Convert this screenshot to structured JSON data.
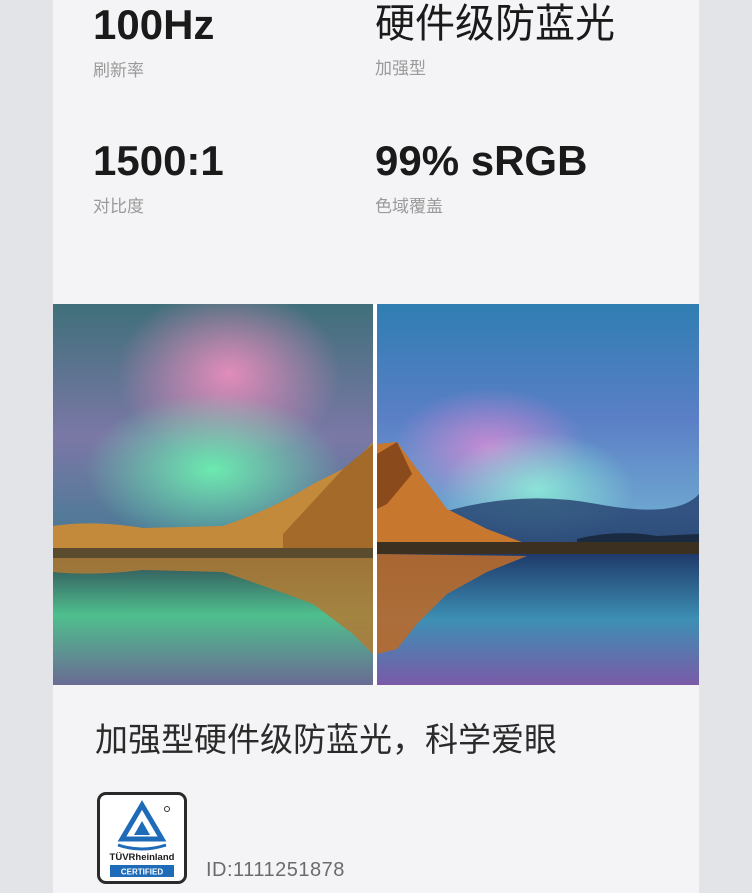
{
  "specs": [
    {
      "value": "100Hz",
      "label": "刷新率"
    },
    {
      "value": "硬件级防蓝光",
      "label": "加强型"
    },
    {
      "value": "1500:1",
      "label": "对比度"
    },
    {
      "value": "99% sRGB",
      "label": "色域覆盖"
    }
  ],
  "comparison": {
    "left_desc": "aurora landscape photo with standard screen tint",
    "right_desc": "aurora landscape photo with blue light filter"
  },
  "caption": "加强型硬件级防蓝光，科学爱眼",
  "certification": {
    "brand_line1": "TÜVRheinland",
    "brand_line2": "CERTIFIED",
    "id_text": "ID:1111251878"
  }
}
